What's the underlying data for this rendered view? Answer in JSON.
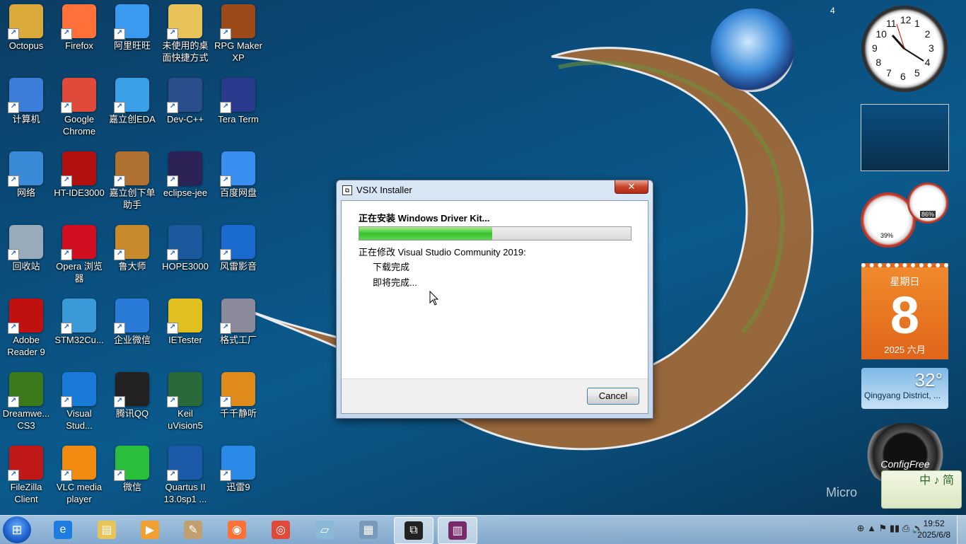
{
  "desktop": {
    "icons": [
      {
        "label": "Octopus",
        "icon": "folder-user-icon",
        "color": "#d9a93a"
      },
      {
        "label": "Firefox",
        "icon": "firefox-icon",
        "color": "#ff7139"
      },
      {
        "label": "阿里旺旺",
        "icon": "aliwangwang-icon",
        "color": "#3a9af0"
      },
      {
        "label": "未使用的桌面快捷方式",
        "icon": "folder-icon",
        "color": "#e8c35a"
      },
      {
        "label": "RPG Maker XP",
        "icon": "rpgmaker-icon",
        "color": "#9c4a1a"
      },
      {
        "label": "计算机",
        "icon": "computer-icon",
        "color": "#3b7dd8"
      },
      {
        "label": "Google Chrome",
        "icon": "chrome-icon",
        "color": "#e04a3a"
      },
      {
        "label": "嘉立创EDA",
        "icon": "cloud-icon",
        "color": "#3aa0e8"
      },
      {
        "label": "Dev-C++",
        "icon": "devcpp-icon",
        "color": "#2a4e8c"
      },
      {
        "label": "Tera Term",
        "icon": "teraterm-icon",
        "color": "#2a3a8c"
      },
      {
        "label": "网络",
        "icon": "network-icon",
        "color": "#3b8ad8"
      },
      {
        "label": "HT-IDE3000",
        "icon": "htide-icon",
        "color": "#b01010"
      },
      {
        "label": "嘉立创下单助手",
        "icon": "bear-icon",
        "color": "#b07030"
      },
      {
        "label": "eclipse-jee",
        "icon": "eclipse-icon",
        "color": "#2c2255"
      },
      {
        "label": "百度网盘",
        "icon": "baidu-netdisk-icon",
        "color": "#3a8ef0"
      },
      {
        "label": "回收站",
        "icon": "recycle-bin-icon",
        "color": "#9ab"
      },
      {
        "label": "Opera 浏览器",
        "icon": "opera-icon",
        "color": "#d01020"
      },
      {
        "label": "鲁大师",
        "icon": "ludashi-icon",
        "color": "#c88a2a"
      },
      {
        "label": "HOPE3000",
        "icon": "hope-icon",
        "color": "#1a5a9c"
      },
      {
        "label": "风雷影音",
        "icon": "media-player-icon",
        "color": "#1a6ad0"
      },
      {
        "label": "Adobe Reader 9",
        "icon": "adobe-reader-icon",
        "color": "#c01010"
      },
      {
        "label": "STM32Cu...",
        "icon": "stm32-icon",
        "color": "#3a9ad8"
      },
      {
        "label": "企业微信",
        "icon": "wework-icon",
        "color": "#2a7ad8"
      },
      {
        "label": "IETester",
        "icon": "ietester-icon",
        "color": "#e0c020"
      },
      {
        "label": "格式工厂",
        "icon": "format-factory-icon",
        "color": "#8a8a9a"
      },
      {
        "label": "Dreamwe... CS3",
        "icon": "dreamweaver-icon",
        "color": "#3a7a1a"
      },
      {
        "label": "Visual Stud...",
        "icon": "vscode-icon",
        "color": "#1a7ad8"
      },
      {
        "label": "腾讯QQ",
        "icon": "qq-icon",
        "color": "#222"
      },
      {
        "label": "Keil uVision5",
        "icon": "keil-icon",
        "color": "#2a6a3a"
      },
      {
        "label": "千千静听",
        "icon": "headphones-icon",
        "color": "#e08a1a"
      },
      {
        "label": "FileZilla Client",
        "icon": "filezilla-icon",
        "color": "#c01818"
      },
      {
        "label": "VLC media player",
        "icon": "vlc-icon",
        "color": "#f08a10"
      },
      {
        "label": "微信",
        "icon": "wechat-icon",
        "color": "#2abf3a"
      },
      {
        "label": "Quartus II 13.0sp1 ...",
        "icon": "quartus-icon",
        "color": "#1a5aa8"
      },
      {
        "label": "迅雷9",
        "icon": "xunlei-icon",
        "color": "#2a8ae8"
      }
    ]
  },
  "dialog": {
    "title": "VSIX Installer",
    "heading": "正在安装 Windows Driver Kit...",
    "progress_fraction": 0.49,
    "status_line": "正在修改 Visual Studio Community 2019:",
    "step1": "下载完成",
    "step2": "即将完成...",
    "close_label": "✕",
    "cancel_label": "Cancel"
  },
  "gadgets": {
    "badge": "4",
    "clock_numbers": [
      "12",
      "1",
      "2",
      "3",
      "4",
      "5",
      "6",
      "7",
      "8",
      "9",
      "10",
      "11"
    ],
    "meters": {
      "cpu": "39%",
      "memory": "86%"
    },
    "calendar": {
      "weekday": "星期日",
      "day": "8",
      "year_month": "2025 六月"
    },
    "weather": {
      "temp": "32°",
      "location": "Qingyang District, ..."
    },
    "configfree": "ConfigFree",
    "ime": "中 ♪ 简",
    "watermark": "Micro"
  },
  "taskbar": {
    "start_icon": "windows-start-icon",
    "items": [
      {
        "name": "ie",
        "icon": "internet-explorer-icon",
        "color": "#1e7ee0",
        "glyph": "e",
        "active": false
      },
      {
        "name": "explorer",
        "icon": "file-explorer-icon",
        "color": "#e8c35a",
        "glyph": "▤",
        "active": false
      },
      {
        "name": "media",
        "icon": "media-player-icon",
        "color": "#f0a030",
        "glyph": "▶",
        "active": false
      },
      {
        "name": "paint",
        "icon": "paint-icon",
        "color": "#c0a070",
        "glyph": "✎",
        "active": false
      },
      {
        "name": "firefox",
        "icon": "firefox-icon",
        "color": "#ff7139",
        "glyph": "◉",
        "active": false
      },
      {
        "name": "chrome",
        "icon": "chrome-icon",
        "color": "#e04a3a",
        "glyph": "◎",
        "active": false
      },
      {
        "name": "notes",
        "icon": "sticky-notes-icon",
        "color": "#8ab8d8",
        "glyph": "▱",
        "active": false
      },
      {
        "name": "calc",
        "icon": "calculator-icon",
        "color": "#7a9aba",
        "glyph": "▦",
        "active": false
      },
      {
        "name": "vsix",
        "icon": "vsix-installer-icon",
        "color": "#222",
        "glyph": "⧉",
        "active": true
      },
      {
        "name": "winrar",
        "icon": "winrar-icon",
        "color": "#7a2a6a",
        "glyph": "▥",
        "active": true
      }
    ],
    "tray_icons": "⊕  ▲  ⚑  ▮▮  ⎙  🔊",
    "time": "19:52",
    "date": "2025/6/8"
  }
}
